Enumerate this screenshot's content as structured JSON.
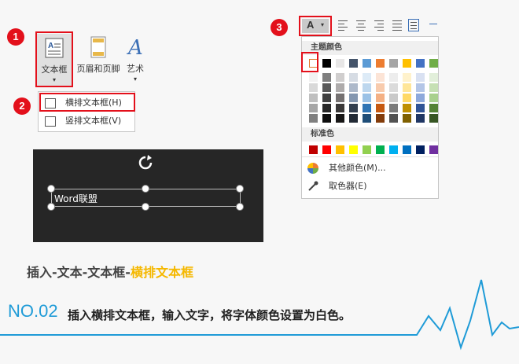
{
  "badges": {
    "one": "1",
    "two": "2",
    "three": "3"
  },
  "ribbon": {
    "textbox_label": "文本框",
    "header_footer_label": "页眉和页脚",
    "wordart_label": "艺术"
  },
  "textbox_menu": {
    "items": [
      {
        "label": "横排文本框(H)"
      },
      {
        "label": "竖排文本框(V)"
      }
    ]
  },
  "canvas": {
    "textbox_text": "Word联盟"
  },
  "caption": {
    "path": "插入-文本-文本框-",
    "highlight": "横排文本框"
  },
  "color_picker": {
    "font_color_button": "A",
    "theme_colors_title": "主题颜色",
    "standard_colors_title": "标准色",
    "more_colors_label": "其他颜色(M)...",
    "eyedropper_label": "取色器(E)",
    "theme_row": [
      "#ffffff",
      "#000000",
      "#e7e6e6",
      "#44546a",
      "#5b9bd5",
      "#ed7d31",
      "#a5a5a5",
      "#ffc000",
      "#4472c4",
      "#70ad47"
    ],
    "shade_columns": [
      [
        "#f2f2f2",
        "#d9d9d9",
        "#bfbfbf",
        "#a6a6a6",
        "#808080"
      ],
      [
        "#7f7f7f",
        "#595959",
        "#404040",
        "#262626",
        "#0d0d0d"
      ],
      [
        "#d0cece",
        "#aeabab",
        "#757171",
        "#3a3838",
        "#171616"
      ],
      [
        "#d6dce4",
        "#adb9ca",
        "#8497b0",
        "#333f4f",
        "#222a35"
      ],
      [
        "#ddebf7",
        "#bdd7ee",
        "#9bc2e6",
        "#2f75b5",
        "#1f4e78"
      ],
      [
        "#fce4d6",
        "#f8cbad",
        "#f4b084",
        "#c65911",
        "#833c0b"
      ],
      [
        "#ededed",
        "#dbdbdb",
        "#c9c9c9",
        "#7b7b7b",
        "#525252"
      ],
      [
        "#fff2cc",
        "#ffe699",
        "#ffd966",
        "#bf8f00",
        "#7f6000"
      ],
      [
        "#d9e1f2",
        "#b4c6e7",
        "#8ea9db",
        "#305496",
        "#203764"
      ],
      [
        "#e2efda",
        "#c6e0b4",
        "#a9d08e",
        "#548235",
        "#375623"
      ]
    ],
    "standard_row": [
      "#c00000",
      "#ff0000",
      "#ffc000",
      "#ffff00",
      "#92d050",
      "#00b050",
      "#00b0f0",
      "#0070c0",
      "#002060",
      "#7030a0"
    ]
  },
  "footer": {
    "number": "NO.02",
    "instruction": "插入横排文本框，输入文字，将字体颜色设置为白色。"
  },
  "colors": {
    "accent_red": "#e3101b",
    "accent_blue": "#1f9bd7",
    "highlight_yellow": "#f5b800"
  }
}
